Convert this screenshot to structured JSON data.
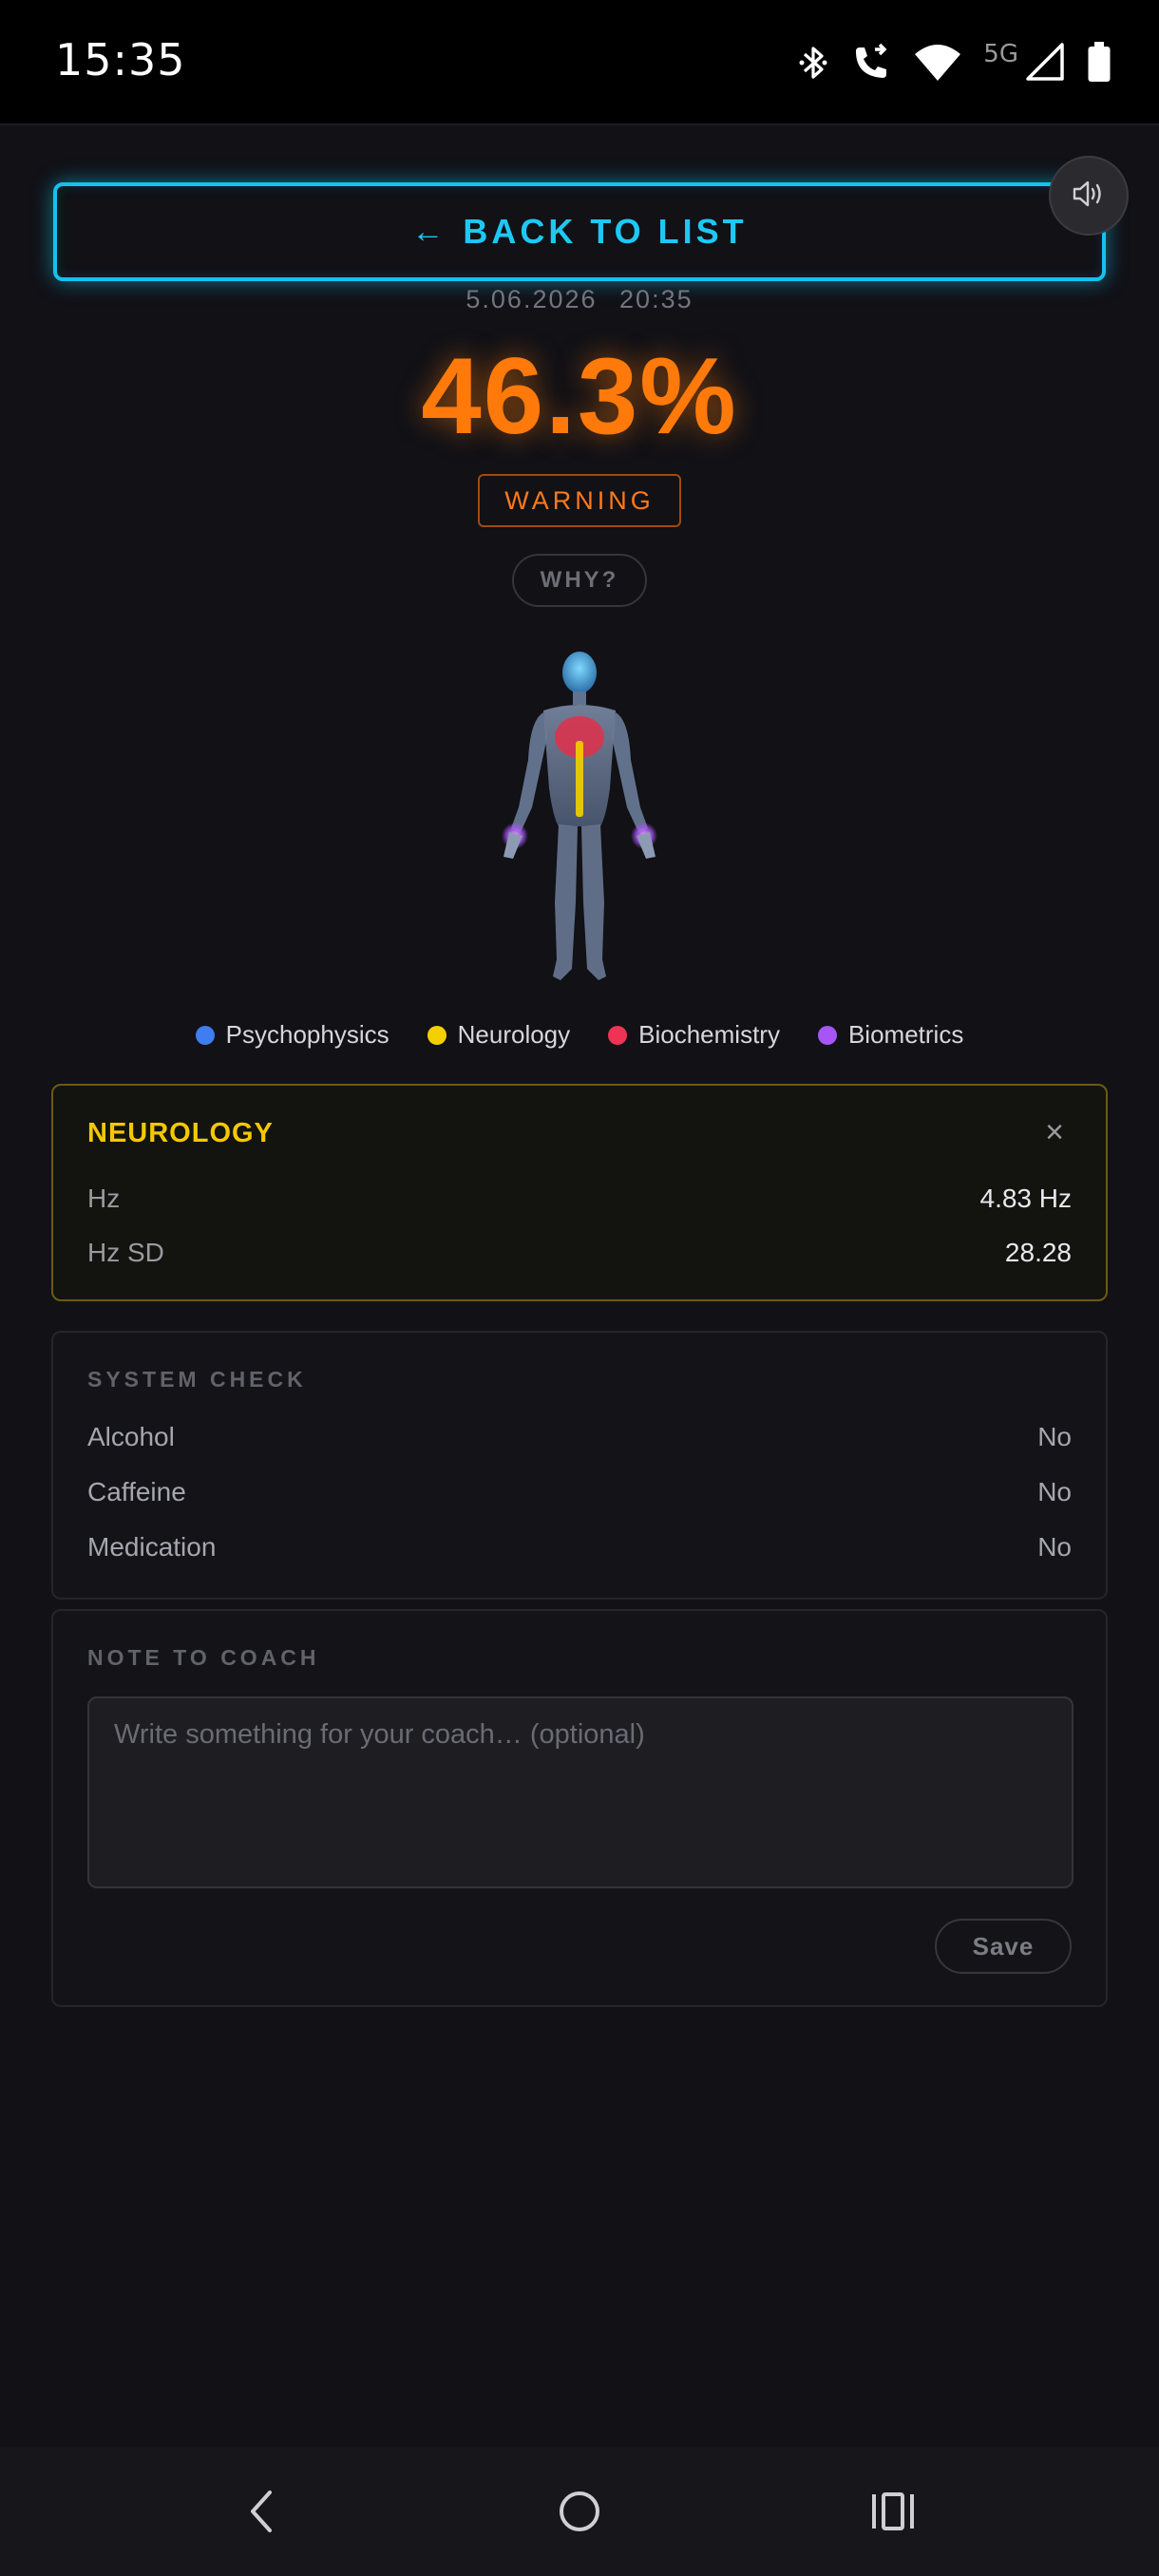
{
  "status_bar": {
    "time": "15:35",
    "network": "5G",
    "icons": [
      "bluetooth-icon",
      "wifi-calling-icon",
      "wifi-icon",
      "cellular-signal-icon",
      "battery-icon"
    ]
  },
  "header": {
    "back_label": "BACK TO LIST",
    "back_arrow": "←",
    "sound_icon": "speaker-icon"
  },
  "result": {
    "date": "5.06.2026",
    "time": "20:35",
    "score": "46.3%",
    "status": "WARNING",
    "why_label": "WHY?",
    "accent_color": "#ff7a0a"
  },
  "legend": [
    {
      "label": "Psychophysics",
      "color": "#3f7df0"
    },
    {
      "label": "Neurology",
      "color": "#f4d000"
    },
    {
      "label": "Biochemistry",
      "color": "#f03355"
    },
    {
      "label": "Biometrics",
      "color": "#a855f7"
    }
  ],
  "neurology": {
    "title": "NEUROLOGY",
    "close": "×",
    "rows": [
      {
        "key": "Hz",
        "value": "4.83 Hz"
      },
      {
        "key": "Hz SD",
        "value": "28.28"
      }
    ]
  },
  "system_check": {
    "title": "SYSTEM CHECK",
    "rows": [
      {
        "key": "Alcohol",
        "value": "No"
      },
      {
        "key": "Caffeine",
        "value": "No"
      },
      {
        "key": "Medication",
        "value": "No"
      }
    ]
  },
  "note": {
    "title": "NOTE TO COACH",
    "placeholder": "Write something for your coach… (optional)",
    "value": "",
    "save_label": "Save"
  },
  "nav": {
    "icons": [
      "back-nav-icon",
      "home-nav-icon",
      "recents-nav-icon"
    ]
  }
}
